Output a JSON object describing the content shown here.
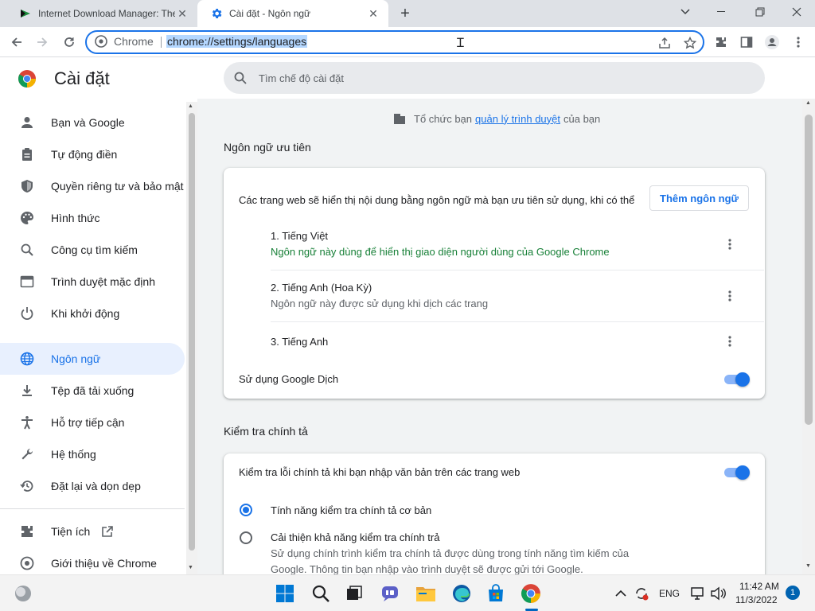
{
  "tabs": [
    {
      "title": "Internet Download Manager: The",
      "active": false
    },
    {
      "title": "Cài đặt - Ngôn ngữ",
      "active": true
    }
  ],
  "new_tab": "+",
  "window": {
    "minimize": "–",
    "restore": "❐",
    "close": "✕",
    "menu_down": "⌄"
  },
  "omnibox": {
    "site_label": "Chrome",
    "url": "chrome://settings/languages"
  },
  "settings": {
    "title": "Cài đặt",
    "search_placeholder": "Tìm chế độ cài đặt",
    "nav": [
      {
        "label": "Bạn và Google",
        "icon": "person-icon"
      },
      {
        "label": "Tự động điền",
        "icon": "clipboard-icon"
      },
      {
        "label": "Quyền riêng tư và bảo mật",
        "icon": "shield-icon"
      },
      {
        "label": "Hình thức",
        "icon": "palette-icon"
      },
      {
        "label": "Công cụ tìm kiếm",
        "icon": "search-icon"
      },
      {
        "label": "Trình duyệt mặc định",
        "icon": "browser-icon"
      },
      {
        "label": "Khi khởi động",
        "icon": "power-icon"
      },
      {
        "label": "Ngôn ngữ",
        "icon": "globe-icon",
        "active": true
      },
      {
        "label": "Tệp đã tải xuống",
        "icon": "download-icon"
      },
      {
        "label": "Hỗ trợ tiếp cận",
        "icon": "accessibility-icon"
      },
      {
        "label": "Hệ thống",
        "icon": "wrench-icon"
      },
      {
        "label": "Đặt lại và dọn dẹp",
        "icon": "history-icon"
      }
    ],
    "nav_extra": [
      {
        "label": "Tiện ích",
        "icon": "puzzle-icon"
      },
      {
        "label": "Giới thiệu về Chrome",
        "icon": "chrome-icon"
      }
    ],
    "managed": {
      "prefix": "Tổ chức bạn",
      "link": "quản lý trình duyệt",
      "suffix": "của bạn"
    },
    "preferred_languages": {
      "section_title": "Ngôn ngữ ưu tiên",
      "description": "Các trang web sẽ hiển thị nội dung bằng ngôn ngữ mà bạn ưu tiên sử dụng, khi có thể",
      "add_button": "Thêm ngôn ngữ",
      "languages": [
        {
          "name": "1. Tiếng Việt",
          "note": "Ngôn ngữ này dùng để hiển thị giao diện người dùng của Google Chrome"
        },
        {
          "name": "2. Tiếng Anh (Hoa Kỳ)",
          "note": "Ngôn ngữ này được sử dụng khi dịch các trang"
        },
        {
          "name": "3. Tiếng Anh",
          "note": ""
        }
      ],
      "translate_label": "Sử dụng Google Dịch",
      "translate_on": true
    },
    "spell_check": {
      "section_title": "Kiểm tra chính tả",
      "toggle_label": "Kiểm tra lỗi chính tả khi bạn nhập văn bản trên các trang web",
      "toggle_on": true,
      "basic_label": "Tính năng kiểm tra chính tả cơ bản",
      "enhanced_label": "Cải thiện khả năng kiểm tra chính trả",
      "enhanced_desc_1": "Sử dụng chính trình kiểm tra chính tả được dùng trong tính năng tìm kiếm của",
      "enhanced_desc_2": "Google. Thông tin bạn nhập vào trình duyệt sẽ được gửi tới Google.",
      "selected": "basic"
    }
  },
  "taskbar": {
    "language": "ENG",
    "time": "11:42 AM",
    "date": "11/3/2022",
    "notifications": "1"
  },
  "colors": {
    "accent": "#1a73e8",
    "active_nav_bg": "#e8f0fe",
    "green_note": "#188038"
  }
}
